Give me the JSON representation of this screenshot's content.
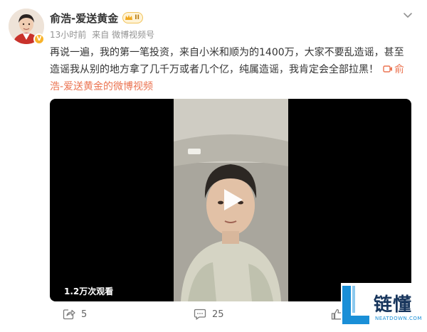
{
  "post": {
    "author": "俞浩-爱送黄金",
    "member_level": "II",
    "time": "13小时前",
    "source": "来自 微博视频号",
    "text": "再说一遍，我的第一笔投资，来自小米和顺为的1400万，大家不要乱造谣，甚至造谣我从别的地方拿了几千万或者几个亿，纯属造谣，我肯定会全部拉黑！",
    "video_link": "俞浩-爱送黄金的微博视频"
  },
  "video": {
    "view_count": "1.2万次观看"
  },
  "actions": {
    "share_count": "5",
    "comment_count": "25"
  },
  "watermark": {
    "name": "链懂",
    "url": "NEATDOWN.COM"
  },
  "colors": {
    "link": "#eb7350",
    "meta": "#939393",
    "badge_gold": "#f8b32a"
  }
}
